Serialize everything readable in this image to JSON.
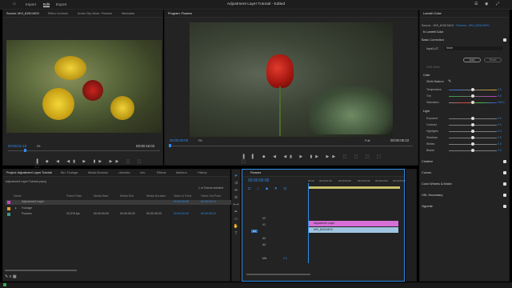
{
  "app": {
    "title": "Adjustment Layer Tutorial - Edited",
    "nav": [
      "Import",
      "Edit",
      "Export"
    ]
  },
  "source_monitor": {
    "tabs": [
      "Source: MVI_8190.MOV",
      "Effect Controls",
      "Audio Clip Mixer: Flowers",
      "Metadata"
    ],
    "timecode_left": "00:00:01:19",
    "fit": "Fit",
    "timecode_right": "00:00:16:02"
  },
  "program_monitor": {
    "tab": "Program: Flowers",
    "timecode_left": "00:00:00:00",
    "fit": "Fit",
    "quality": "Full",
    "timecode_right": "00:00:05:22"
  },
  "lumetri": {
    "tab": "Lumetri Color",
    "source": "Source - MVI_8190.MOV",
    "target": "Flowers - MVI_8190.MOV",
    "effect": "Lumetri Color",
    "basic_correction": "Basic Correction",
    "input_lut_label": "Input LUT",
    "input_lut_value": "None",
    "hdr_white": "HDR White",
    "auto": "Auto",
    "reset": "Reset",
    "color_header": "Color",
    "white_balance": "White Balance",
    "color_sliders": [
      {
        "label": "Temperature",
        "value": "0.0"
      },
      {
        "label": "Tint",
        "value": "0.0"
      },
      {
        "label": "Saturation",
        "value": "100.0"
      }
    ],
    "light_header": "Light",
    "light_sliders": [
      {
        "label": "Exposure",
        "value": "0.0"
      },
      {
        "label": "Contrast",
        "value": "0.0"
      },
      {
        "label": "Highlights",
        "value": "0.0"
      },
      {
        "label": "Shadows",
        "value": "0.0"
      },
      {
        "label": "Whites",
        "value": "0.0"
      },
      {
        "label": "Blacks",
        "value": "0.0"
      }
    ],
    "sections": [
      "Creative",
      "Curves",
      "Color Wheels & Match",
      "HSL Secondary",
      "Vignette"
    ]
  },
  "project": {
    "tabs": [
      "Project: Adjustment Layer Tutorial",
      "Bin: Footage",
      "Media Browser",
      "Libraries",
      "Info",
      "Effects",
      "Markers",
      "History"
    ],
    "file": "Adjustment Layer Tutorial.prproj",
    "selected": "1 of 3 items selected",
    "columns": [
      "Name",
      "Frame Rate",
      "Media Start",
      "Media End",
      "Media Duration",
      "Video In Point",
      "Video Out Point"
    ],
    "rows": [
      {
        "name": "Adjustment Layer",
        "fps": "",
        "start": "",
        "end": "",
        "dur": "",
        "in": "00:00:00:00",
        "out": "00:00:04:22",
        "color": "#c04ac0"
      },
      {
        "name": "Footage",
        "fps": "",
        "start": "",
        "end": "",
        "dur": "",
        "in": "",
        "out": "",
        "color": "#e0a526"
      },
      {
        "name": "Flowers",
        "fps": "23.976 fps",
        "start": "00:00:00:00",
        "end": "00:00:05:22",
        "dur": "00:00:05:23",
        "in": "00:00:00:00",
        "out": "00:00:05:22",
        "color": "#3c9a8a"
      }
    ]
  },
  "timeline": {
    "tab": "Flowers",
    "timecode": "00:00:00:00",
    "ruler": [
      "00:00",
      "00:00:01:00",
      "00:00:02:00",
      "00:00:03:00",
      "00:00:04:00",
      "00:00:05:00"
    ],
    "track_v2": "V2",
    "track_v1": "V1",
    "track_a1": "A1",
    "track_a2": "A2",
    "track_a3": "A3",
    "master": "Mix",
    "master_value": "0.0",
    "clip_adjust": "Adjustment Layer",
    "clip_video": "MVI_8190.MOV"
  }
}
